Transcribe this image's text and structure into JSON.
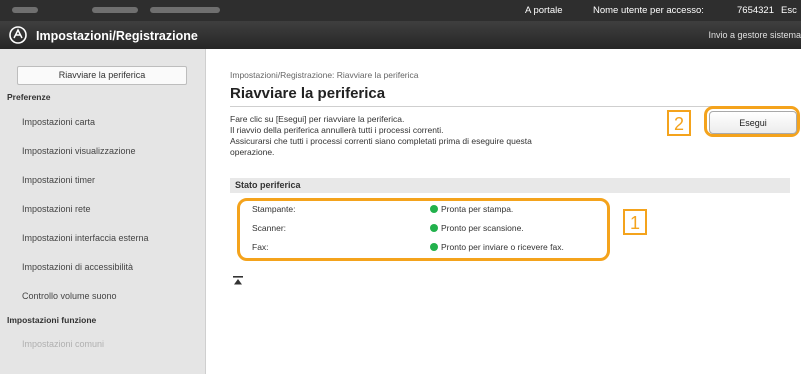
{
  "topbar": {
    "portal_link": "A portale",
    "user_label": "Nome utente per accesso:",
    "user_id": "7654321",
    "logout": "Esc"
  },
  "header": {
    "app_title": "Impostazioni/Registrazione",
    "admin_link": "Invio a gestore sistema"
  },
  "sidebar": {
    "restart_button": "Riavviare la periferica",
    "section_preferences": "Preferenze",
    "preference_items": [
      "Impostazioni carta",
      "Impostazioni visualizzazione",
      "Impostazioni timer",
      "Impostazioni rete",
      "Impostazioni interfaccia esterna",
      "Impostazioni di accessibilità",
      "Controllo volume suono"
    ],
    "section_functions": "Impostazioni funzione",
    "function_items": [
      "Impostazioni comuni"
    ]
  },
  "main": {
    "breadcrumb": "Impostazioni/Registrazione: Riavviare la periferica",
    "title": "Riavviare la periferica",
    "description": [
      "Fare clic su [Esegui] per riavviare la periferica.",
      "Il riavvio della periferica annullerà tutti i processi correnti.",
      "Assicurarsi che tutti i processi correnti siano completati prima di eseguire questa",
      "operazione."
    ],
    "execute_button": "Esegui",
    "status_header": "Stato periferica",
    "status_rows": [
      {
        "label": "Stampante:",
        "value": "Pronta per stampa."
      },
      {
        "label": "Scanner:",
        "value": "Pronto per scansione."
      },
      {
        "label": "Fax:",
        "value": "Pronto per inviare o ricevere fax."
      }
    ],
    "callouts": [
      "1",
      "2"
    ]
  },
  "colors": {
    "highlight": "#f4a31c",
    "status_ok": "#22b14c",
    "title_bar": "#2e2e2e"
  },
  "icons": [
    "logo-icon",
    "status-ok-icon",
    "back-to-top-icon"
  ]
}
